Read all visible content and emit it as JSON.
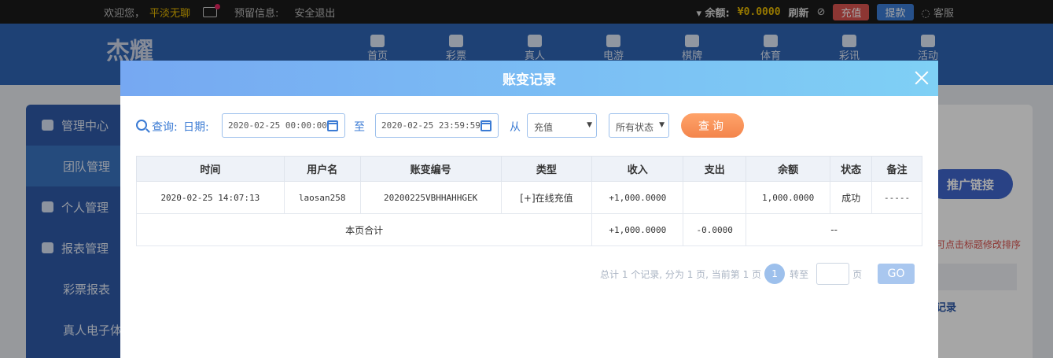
{
  "topbar": {
    "welcome": "欢迎您，",
    "username": "平淡无聊",
    "notice_label": "预留信息:",
    "logout": "安全退出",
    "balance_label": "余额:",
    "balance_value": "¥0.0000",
    "refresh": "刷新",
    "recharge": "充值",
    "withdraw": "提款",
    "service": "客服"
  },
  "header": {
    "logo_text": "杰耀",
    "nav": [
      "首页",
      "彩票",
      "真人",
      "电游",
      "棋牌",
      "体育",
      "彩讯",
      "活动"
    ]
  },
  "sidebar": {
    "items": [
      {
        "label": "管理中心"
      },
      {
        "label": "团队管理"
      },
      {
        "label": "个人管理"
      },
      {
        "label": "报表管理"
      },
      {
        "label": "彩票报表"
      },
      {
        "label": "真人电子体"
      }
    ]
  },
  "background": {
    "promo_button": "推广链接",
    "sort_hint": "可点击标题修改排序",
    "record_link": "记录"
  },
  "modal": {
    "title": "账变记录",
    "query_label": "查询:",
    "date_label": "日期:",
    "start_date": "2020-02-25 00:00:00",
    "to_label": "至",
    "end_date": "2020-02-25 23:59:59",
    "from_label": "从",
    "type_select": "充值",
    "status_select": "所有状态",
    "search_button": "查询",
    "columns": [
      "时间",
      "用户名",
      "账变编号",
      "类型",
      "收入",
      "支出",
      "余额",
      "状态",
      "备注"
    ],
    "rows": [
      {
        "time": "2020-02-25 14:07:13",
        "user": "laosan258",
        "order_no": "20200225VBHHAHHGEK",
        "type": "[+]在线充值",
        "income": "+1,000.0000",
        "expense": "",
        "balance": "1,000.0000",
        "status": "成功",
        "remark": "-----"
      }
    ],
    "summary": {
      "label": "本页合计",
      "income": "+1,000.0000",
      "expense": "-0.0000",
      "rest": "--"
    },
    "pager": {
      "text_total": "总计 1 个记录, 分为 1 页, 当前第 1 页",
      "current_page": "1",
      "goto_label": "转至",
      "page_unit": "页",
      "go_button": "GO"
    }
  }
}
